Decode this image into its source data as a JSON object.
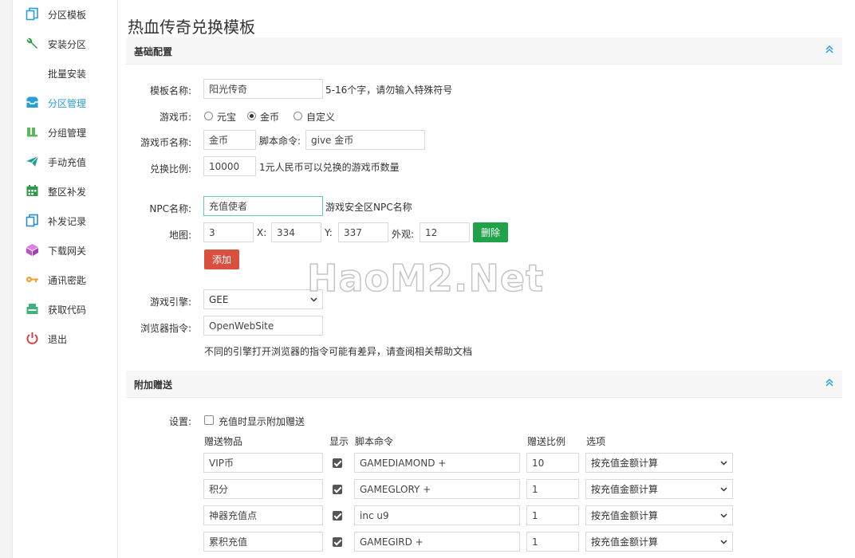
{
  "sidebar": {
    "items": [
      {
        "label": "分区模板",
        "icon": "copy-icon",
        "color": "#2a9fd6"
      },
      {
        "label": "安装分区",
        "icon": "wrench-icon",
        "color": "#2e9a46"
      },
      {
        "label": "批量安装",
        "icon": "",
        "color": ""
      },
      {
        "label": "分区管理",
        "icon": "inbox-icon",
        "color": "#2a9fd6",
        "active": true
      },
      {
        "label": "分组管理",
        "icon": "users-icon",
        "color": "#5cb85c"
      },
      {
        "label": "手动充值",
        "icon": "send-icon",
        "color": "#1e9e9a"
      },
      {
        "label": "整区补发",
        "icon": "calendar-icon",
        "color": "#2e9a46"
      },
      {
        "label": "补发记录",
        "icon": "copy-icon",
        "color": "#2a8ec6"
      },
      {
        "label": "下载网关",
        "icon": "box-icon",
        "color": "#c34fd0"
      },
      {
        "label": "通讯密匙",
        "icon": "key-icon",
        "color": "#f0a030"
      },
      {
        "label": "获取代码",
        "icon": "register-icon",
        "color": "#3cb37a"
      },
      {
        "label": "退出",
        "icon": "power-icon",
        "color": "#d9403a"
      }
    ]
  },
  "page": {
    "title": "热血传奇兑换模板"
  },
  "basic": {
    "title": "基础配置",
    "template_name_label": "模板名称:",
    "template_name_value": "阳光传奇",
    "template_name_hint": "5-16个字，请勿输入特殊符号",
    "currency_label": "游戏币:",
    "currency_options": [
      "元宝",
      "金币",
      "自定义"
    ],
    "currency_selected": "金币",
    "currency_name_label": "游戏币名称:",
    "currency_name_value": "金币",
    "script_cmd_label": "脚本命令:",
    "script_cmd_value": "give 金币",
    "ratio_label": "兑换比例:",
    "ratio_value": "10000",
    "ratio_hint": "1元人民币可以兑换的游戏币数量",
    "npc_label": "NPC名称:",
    "npc_value": "充值使者",
    "npc_hint": "游戏安全区NPC名称",
    "map_label": "地图:",
    "map_value": "3",
    "x_label": "X:",
    "x_value": "334",
    "y_label": "Y:",
    "y_value": "337",
    "look_label": "外观:",
    "look_value": "12",
    "delete_label": "删除",
    "add_label": "添加",
    "engine_label": "游戏引擎:",
    "engine_value": "GEE",
    "browser_label": "浏览器指令:",
    "browser_value": "OpenWebSite",
    "browser_hint": "不同的引擎打开浏览器的指令可能有差异，请查阅相关帮助文档"
  },
  "bonus": {
    "title": "附加赠送",
    "settings_label": "设置:",
    "show_bonus_label": "充值时显示附加赠送",
    "show_bonus_checked": false,
    "columns": [
      "赠送物品",
      "显示",
      "脚本命令",
      "赠送比例",
      "选项"
    ],
    "rows": [
      {
        "item": "VIP币",
        "show": true,
        "cmd": "GAMEDIAMOND +",
        "ratio": "10",
        "option": "按充值金额计算"
      },
      {
        "item": "积分",
        "show": true,
        "cmd": "GAMEGLORY +",
        "ratio": "1",
        "option": "按充值金额计算"
      },
      {
        "item": "神器充值点",
        "show": true,
        "cmd": "inc u9",
        "ratio": "1",
        "option": "按充值金额计算"
      },
      {
        "item": "累积充值",
        "show": true,
        "cmd": "GAMEGIRD +",
        "ratio": "1",
        "option": "按充值金额计算"
      }
    ]
  },
  "watermark": "HaoM2.Net"
}
